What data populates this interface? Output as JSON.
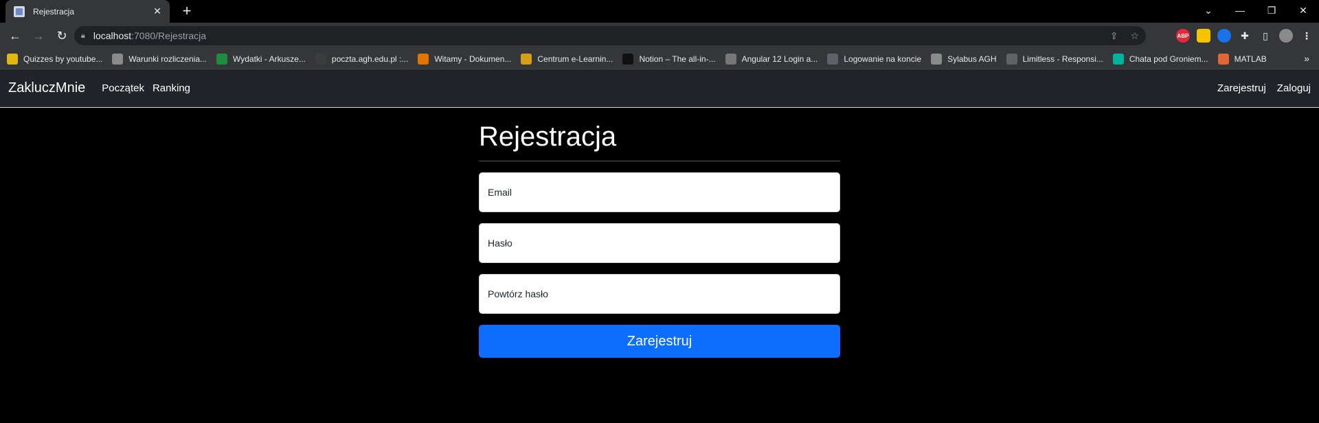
{
  "browser": {
    "tab_title": "Rejestracja",
    "url_host": "localhost",
    "url_rest": ":7080/Rejestracja",
    "bookmarks": [
      {
        "label": "Quizzes by youtube...",
        "color": "#e2b714"
      },
      {
        "label": "Warunki rozliczenia...",
        "color": "#8a8a8a"
      },
      {
        "label": "Wydatki - Arkusze...",
        "color": "#1e8e3e"
      },
      {
        "label": "poczta.agh.edu.pl :...",
        "color": "#3c3c3c"
      },
      {
        "label": "Witamy - Dokumen...",
        "color": "#e37400"
      },
      {
        "label": "Centrum e-Learnin...",
        "color": "#d4a017"
      },
      {
        "label": "Notion – The all-in-...",
        "color": "#111111"
      },
      {
        "label": "Angular 12 Login a...",
        "color": "#777777"
      },
      {
        "label": "Logowanie na koncie",
        "color": "#5f6368"
      },
      {
        "label": "Sylabus AGH",
        "color": "#8a8a8a"
      },
      {
        "label": "Limitless - Responsi...",
        "color": "#5f6368"
      },
      {
        "label": "Chata pod Groniem...",
        "color": "#00b39f"
      },
      {
        "label": "MATLAB",
        "color": "#e16737"
      }
    ],
    "extensions": [
      {
        "icon": "adblock-icon",
        "label": "ABP",
        "color": "#e8273a"
      },
      {
        "icon": "extension-yellow-icon",
        "label": "",
        "color": "#f5c400"
      },
      {
        "icon": "shazam-icon",
        "label": "",
        "color": "#1a73e8"
      }
    ]
  },
  "app": {
    "brand": "ZakluczMnie",
    "nav_links": [
      "Początek",
      "Ranking"
    ],
    "nav_right": [
      "Zarejestruj",
      "Zaloguj"
    ]
  },
  "form": {
    "heading": "Rejestracja",
    "email_placeholder": "Email",
    "password_placeholder": "Hasło",
    "password_repeat_placeholder": "Powtórz hasło",
    "submit_label": "Zarejestruj",
    "submit_color": "#0d6efd"
  }
}
